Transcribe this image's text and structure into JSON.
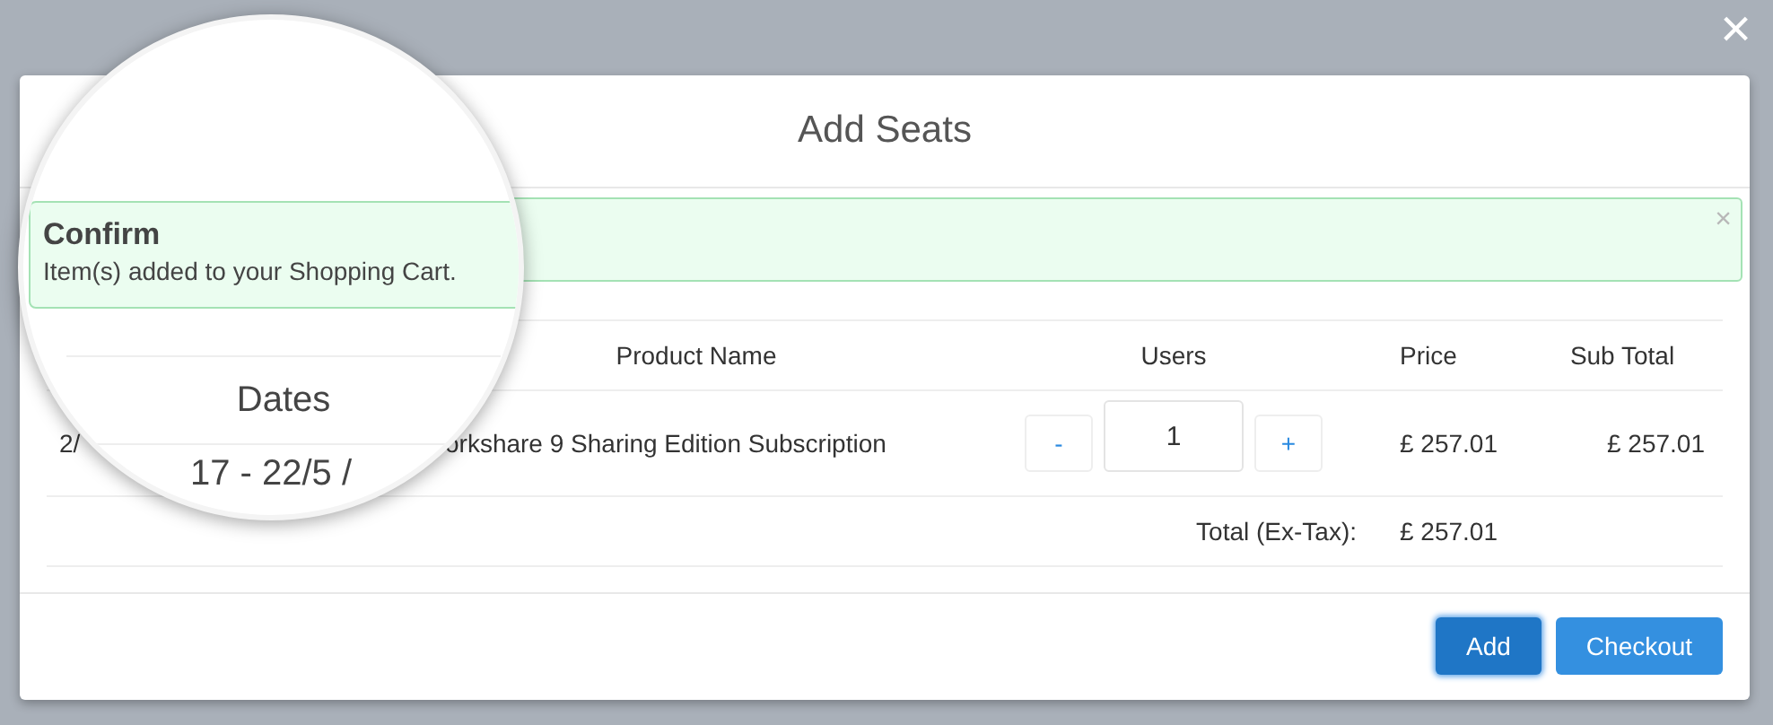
{
  "page_close": "×",
  "modal": {
    "title": "Add Seats",
    "alert": {
      "dismiss": "×"
    },
    "table": {
      "columns": [
        "Product Name",
        "Users",
        "Price",
        "Sub Total"
      ],
      "rows": [
        {
          "date": "2/",
          "product": "orkshare 9 Sharing Edition Subscription",
          "decrement": "-",
          "users": "1",
          "increment": "+",
          "price": "£ 257.01",
          "subtotal": "£ 257.01"
        }
      ],
      "total_label": "Total (Ex-Tax):",
      "total": "£ 257.01"
    },
    "buttons": [
      {
        "label": "Add",
        "kind": "primary"
      },
      {
        "label": "Checkout",
        "kind": "secondary"
      }
    ]
  },
  "magnifier": {
    "alert": {
      "title": "Confirm",
      "message": "Item(s) added to your Shopping Cart."
    },
    "column": "Dates",
    "date_fragment": "17 - 22/5 /"
  }
}
